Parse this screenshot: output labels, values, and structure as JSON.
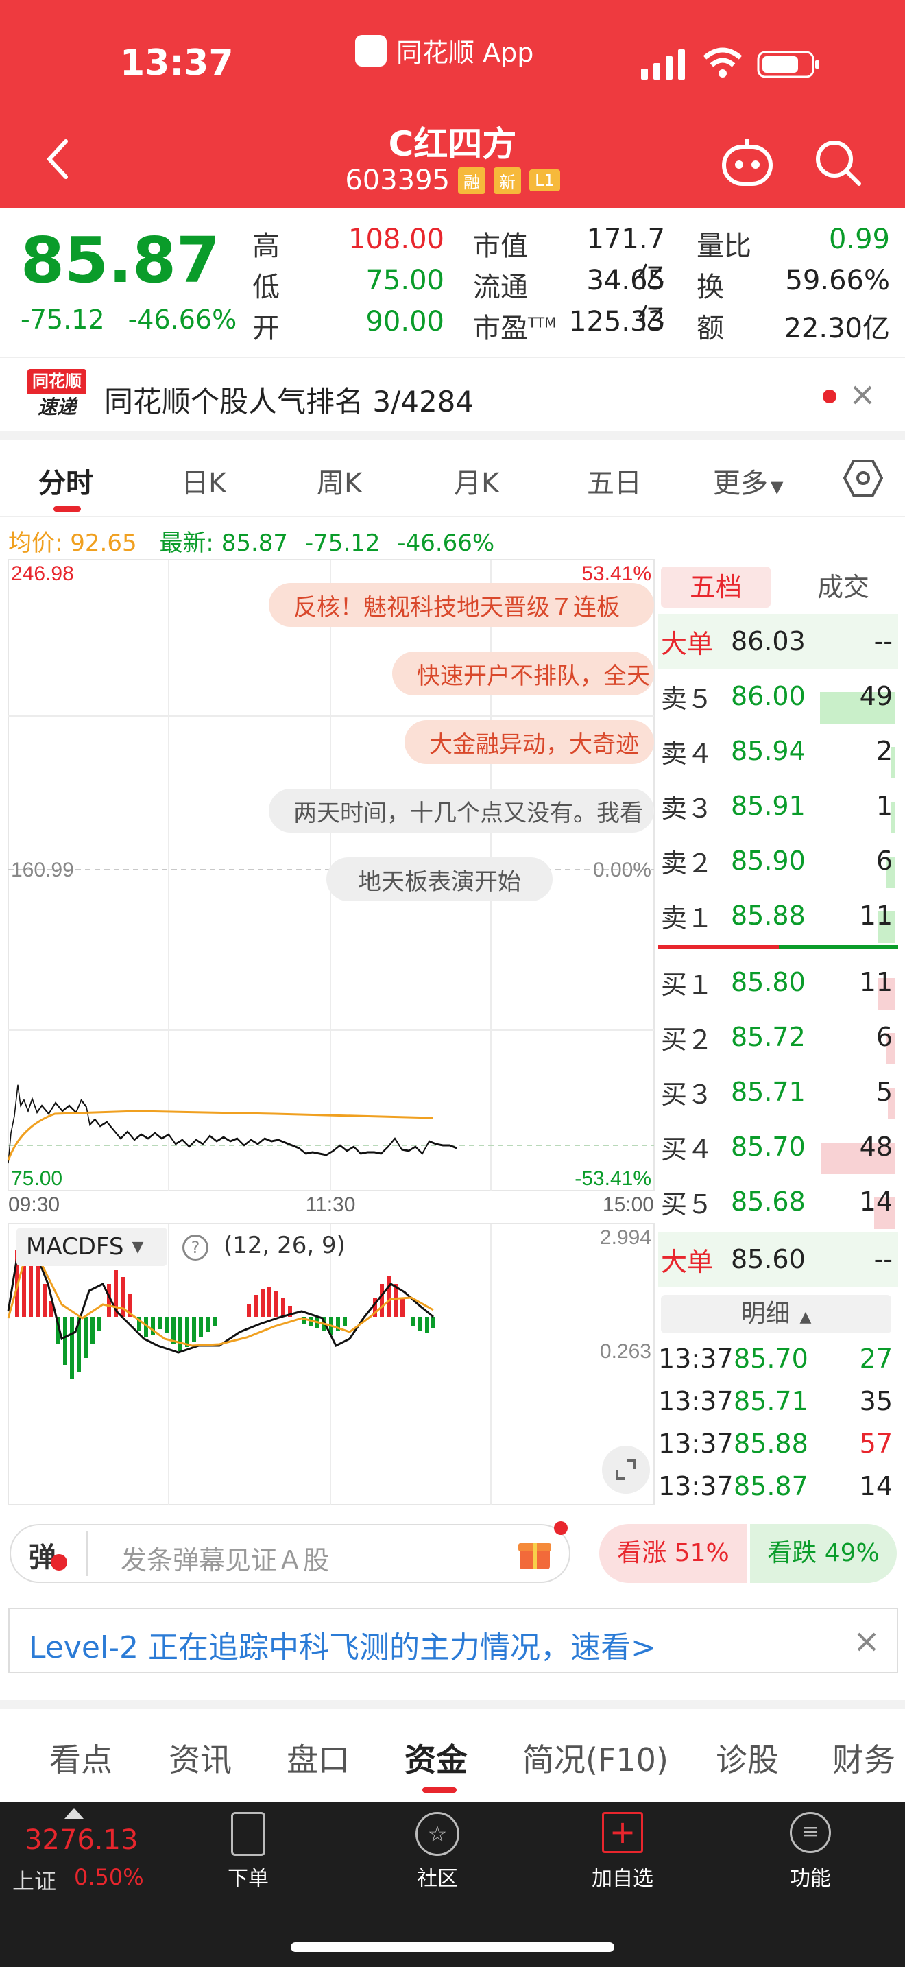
{
  "status": {
    "time": "13:37",
    "app": "同花顺 App"
  },
  "header": {
    "title": "C红四方",
    "code": "603395",
    "tags": [
      "融",
      "新",
      "L1"
    ]
  },
  "quote": {
    "price": "85.87",
    "change": "-75.12",
    "change_pct": "-46.66%",
    "high_label": "高",
    "high": "108.00",
    "low_label": "低",
    "low": "75.00",
    "open_label": "开",
    "open": "90.00",
    "mktcap_label": "市值",
    "mktcap": "171.7亿",
    "float_label": "流通",
    "float": "34.65亿",
    "pe_label": "市盈",
    "pe_sup": "TTM",
    "pe": "125.33",
    "volratio_label": "量比",
    "volratio": "0.99",
    "turnover_label": "换",
    "turnover": "59.66%",
    "amount_label": "额",
    "amount": "22.30亿"
  },
  "notice": {
    "logo_top": "同花顺",
    "logo_bottom": "速递",
    "text": "同花顺个股人气排名 3/4284"
  },
  "tabs": [
    "分时",
    "日K",
    "周K",
    "月K",
    "五日",
    "更多"
  ],
  "summary": {
    "avg_label": "均价:",
    "avg": "92.65",
    "last_label": "最新:",
    "last": "85.87",
    "chg": "-75.12",
    "pct": "-46.66%"
  },
  "chart": {
    "y_top": "246.98",
    "y_top_pct": "53.41%",
    "y_mid": "160.99",
    "y_mid_pct": "0.00%",
    "y_bot": "75.00",
    "y_bot_pct": "-53.41%",
    "x_labels": [
      "09:30",
      "11:30",
      "15:00"
    ],
    "macd_label": "MACDFS",
    "macd_params": "(12, 26, 9)",
    "macd_top": "2.994",
    "macd_mid": "0.263"
  },
  "bubbles": [
    "反核！魅视科技地天晋级７连板",
    "快速开户不排队，全天",
    "大金融异动，大奇迹",
    "两天时间，十几个点又没有。我看",
    "地天板表演开始"
  ],
  "orderbook": {
    "tab_active": "五档",
    "tab_other": "成交",
    "big_sell_label": "大单",
    "big_sell_price": "86.03",
    "big_sell_vol": "--",
    "sells": [
      {
        "label": "卖５",
        "price": "86.00",
        "vol": "49"
      },
      {
        "label": "卖４",
        "price": "85.94",
        "vol": "2"
      },
      {
        "label": "卖３",
        "price": "85.91",
        "vol": "1"
      },
      {
        "label": "卖２",
        "price": "85.90",
        "vol": "6"
      },
      {
        "label": "卖１",
        "price": "85.88",
        "vol": "11"
      }
    ],
    "buys": [
      {
        "label": "买１",
        "price": "85.80",
        "vol": "11"
      },
      {
        "label": "买２",
        "price": "85.72",
        "vol": "6"
      },
      {
        "label": "买３",
        "price": "85.71",
        "vol": "5"
      },
      {
        "label": "买４",
        "price": "85.70",
        "vol": "48"
      },
      {
        "label": "买５",
        "price": "85.68",
        "vol": "14"
      }
    ],
    "big_buy_label": "大单",
    "big_buy_price": "85.60",
    "big_buy_vol": "--",
    "detail_label": "明细",
    "details": [
      {
        "time": "13:37",
        "price": "85.70",
        "vol": "27",
        "color": "#0a9c2a"
      },
      {
        "time": "13:37",
        "price": "85.71",
        "vol": "35",
        "color": "#222222"
      },
      {
        "time": "13:37",
        "price": "85.88",
        "vol": "57",
        "color": "#e8262d"
      },
      {
        "time": "13:37",
        "price": "85.87",
        "vol": "14",
        "color": "#222222"
      }
    ]
  },
  "danmu": {
    "icon": "弹",
    "placeholder": "发条弹幕见证Ａ股",
    "up": "看涨 51%",
    "down": "看跌 49%"
  },
  "banner": {
    "text": "Level-2 正在追踪中科飞测的主力情况，速看>"
  },
  "bottom_tabs": [
    "看点",
    "资讯",
    "盘口",
    "资金",
    "简况(F10)",
    "诊股",
    "财务"
  ],
  "navbar": {
    "index_value": "3276.13",
    "index_name": "上证",
    "index_pct": "0.50%",
    "items": [
      "下单",
      "社区",
      "加自选",
      "功能"
    ]
  },
  "colors": {
    "header": "#ee3a3f",
    "up": "#e8262d",
    "down": "#0a9c2a"
  }
}
